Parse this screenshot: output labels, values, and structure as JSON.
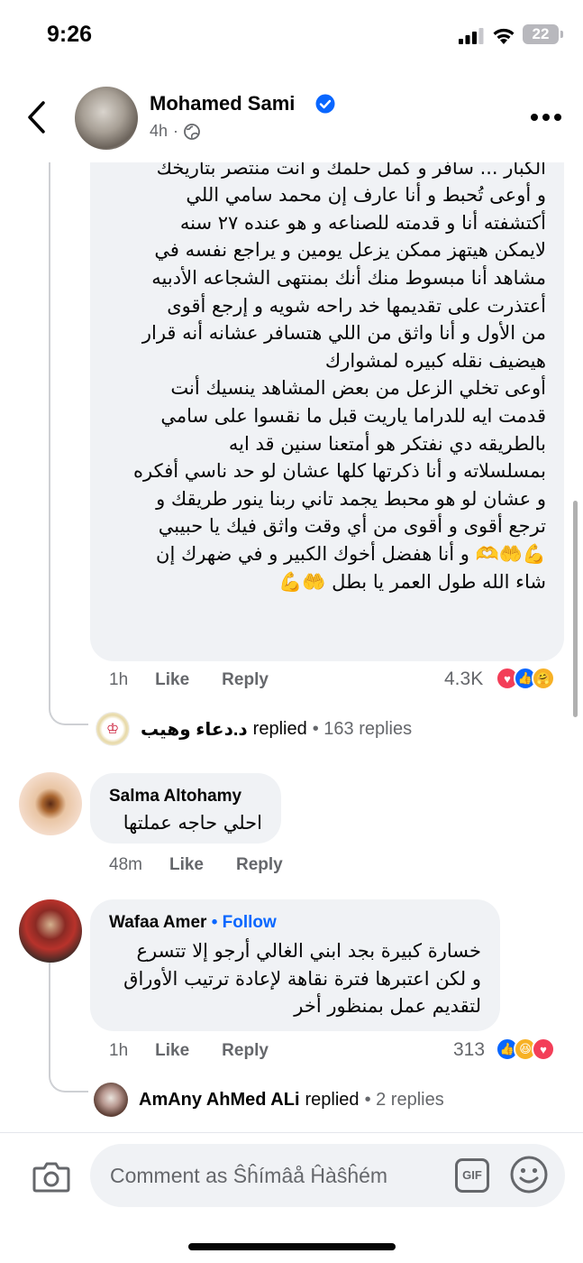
{
  "status_bar": {
    "time": "9:26",
    "battery": "22"
  },
  "post": {
    "author": "Mohamed Sami",
    "time": "4h",
    "visibility_icon": "globe-icon"
  },
  "main_comment": {
    "text": "بيبقى على قد حجمك و سي دي ضريبة الناجحين\nالكبار  ... سافر و كمل حلمك و أنت منتصر بتاريخك\nو أوعى تُحبط و أنا عارف إن محمد سامي اللي\nأكتشفته أنا و قدمته للصناعه و هو عنده ٢٧ سنه\nلايمكن هيتهز  ممكن يزعل يومين و يراجع نفسه في\nمشاهد أنا مبسوط منك أنك بمنتهى الشجاعه الأدبيه\nأعتذرت على تقديمها  خد راحه شويه و إرجع أقوى\nمن الأول و أنا واثق من اللي هتسافر عشانه أنه قرار\nهيضيف نقله كبيره لمشوارك\nأوعى تخلي الزعل من بعض المشاهد ينسيك أنت\nقدمت ايه للدراما  ياريت قبل ما نقسوا على سامي\nبالطريقه دي نفتكر هو أمتعنا سنين قد ايه\nبمسلسلاته و أنا ذكرتها كلها عشان لو حد ناسي أفكره\nو عشان لو هو محبط يجمد تاني    ربنا ينور طريقك و\nترجع أقوى و أقوى من أي وقت  واثق فيك يا حبيبي\n💪🤲🫶 و أنا هفضل أخوك الكبير و في ضهرك إن\nشاء الله طول العمر يا بطل 🤲💪",
    "time": "1h",
    "like": "Like",
    "reply": "Reply",
    "reaction_count": "4.3K",
    "replies": {
      "name": "د.دعاء وهيب",
      "replied": "replied",
      "count": "• 163 replies"
    }
  },
  "comments": [
    {
      "name": "Salma Altohamy",
      "text": "احلي حاجه عملتها",
      "time": "48m",
      "like": "Like",
      "reply": "Reply"
    },
    {
      "name": "Wafaa Amer",
      "follow": "• Follow",
      "text": "خسارة كبيرة بجد ابني الغالي أرجو إلا تتسرع\nو لكن اعتبرها فترة نقاهة لإعادة ترتيب الأوراق\nلتقديم عمل بمنظور أخر",
      "time": "1h",
      "like": "Like",
      "reply": "Reply",
      "reaction_count": "313",
      "replies": {
        "name": "AmAny AhMed ALi",
        "replied": "replied",
        "count": "• 2 replies"
      }
    }
  ],
  "composer": {
    "placeholder": "Comment as Ŝĥímâå Ĥàŝĥém",
    "gif": "GIF"
  },
  "colors": {
    "accent": "#0866ff",
    "love": "#f33e58",
    "haha": "#f7b125"
  }
}
